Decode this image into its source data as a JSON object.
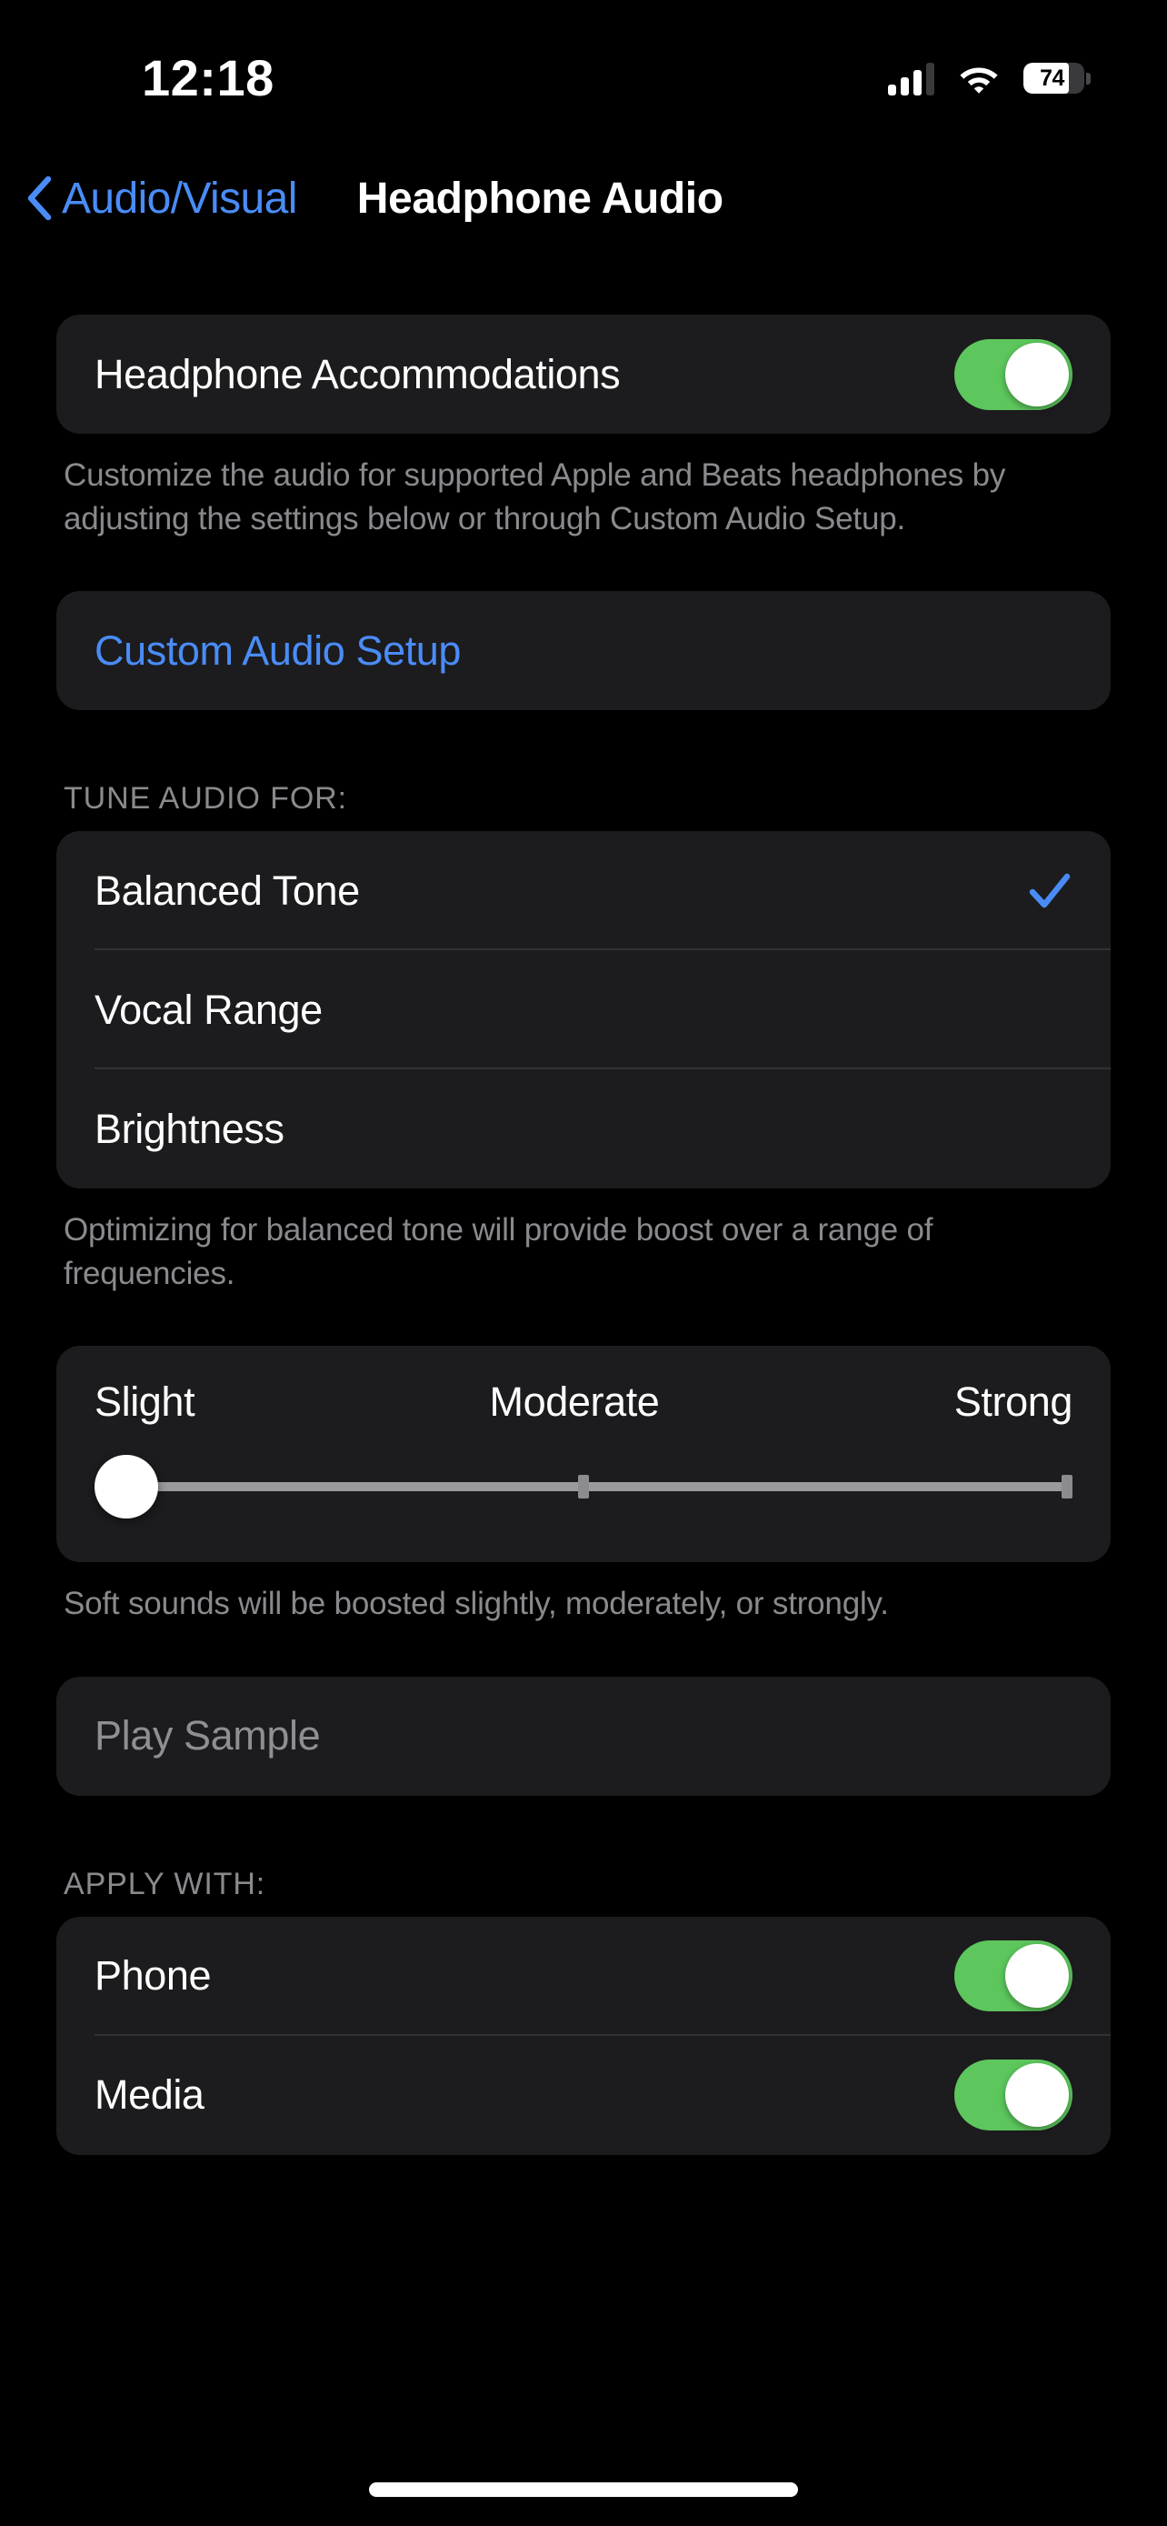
{
  "status_bar": {
    "time": "12:18",
    "signal_icon": "cellular-signal-icon",
    "signal_bars_filled": 3,
    "signal_bars_total": 4,
    "wifi_icon": "wifi-icon",
    "battery_icon": "battery-icon",
    "battery_percent": "74",
    "battery_level": 74
  },
  "nav": {
    "back_icon": "chevron-left-icon",
    "back_label": "Audio/Visual",
    "title": "Headphone Audio"
  },
  "accommodations": {
    "label": "Headphone Accommodations",
    "toggle_state": "on",
    "toggle_name": "headphone-accommodations-toggle",
    "footer": "Customize the audio for supported Apple and Beats headphones by adjusting the settings below or through Custom Audio Setup."
  },
  "custom_setup": {
    "label": "Custom Audio Setup"
  },
  "tune_audio": {
    "header": "TUNE AUDIO FOR:",
    "options": [
      {
        "label": "Balanced Tone",
        "selected": true
      },
      {
        "label": "Vocal Range",
        "selected": false
      },
      {
        "label": "Brightness",
        "selected": false
      }
    ],
    "check_icon": "checkmark-icon",
    "footer": "Optimizing for balanced tone will provide boost over a range of frequencies."
  },
  "strength_slider": {
    "left_label": "Slight",
    "center_label": "Moderate",
    "right_label": "Strong",
    "value": 0,
    "min": 0,
    "max": 2,
    "footer": "Soft sounds will be boosted slightly, moderately, or strongly."
  },
  "play_sample": {
    "label": "Play Sample",
    "enabled": false
  },
  "apply_with": {
    "header": "APPLY WITH:",
    "rows": [
      {
        "label": "Phone",
        "toggle_state": "on"
      },
      {
        "label": "Media",
        "toggle_state": "on"
      }
    ]
  },
  "colors": {
    "background": "#000000",
    "card": "#1c1c1e",
    "accent_blue": "#4a8cf7",
    "toggle_green": "#5dc75d",
    "secondary_text": "#8a8a8e",
    "separator": "#323234"
  }
}
